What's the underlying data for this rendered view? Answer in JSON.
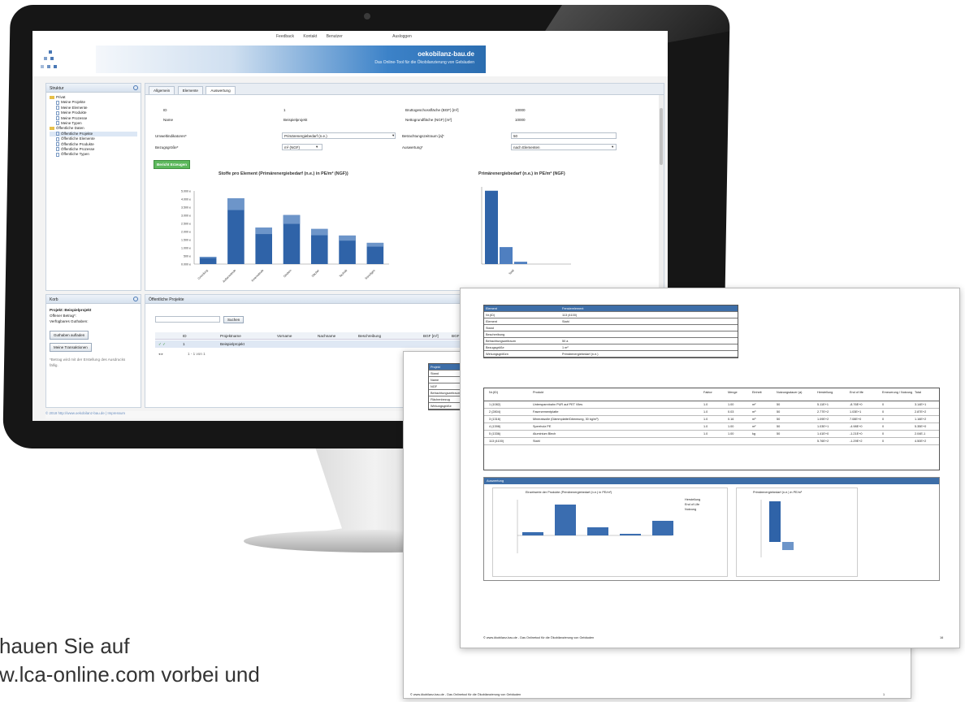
{
  "app": {
    "brand": "oekobilanz-bau.de",
    "tagline": "Das Online-Tool für die Ökobilanzierung von Gebäuden",
    "top_links": [
      "Feedback",
      "Kontakt",
      "Benutzer",
      "Ausloggen"
    ]
  },
  "explorer": {
    "title": "Struktur",
    "items": [
      {
        "label": "Privat",
        "kind": "folder",
        "level": 0
      },
      {
        "label": "Meine Projekte",
        "kind": "doc",
        "level": 1
      },
      {
        "label": "Meine Elemente",
        "kind": "doc",
        "level": 1
      },
      {
        "label": "Meine Produkte",
        "kind": "doc",
        "level": 1
      },
      {
        "label": "Meine Prozesse",
        "kind": "doc",
        "level": 1
      },
      {
        "label": "Meine Typen",
        "kind": "doc",
        "level": 1
      },
      {
        "label": "Öffentliche Daten",
        "kind": "folder",
        "level": 0
      },
      {
        "label": "Öffentliche Projekte",
        "kind": "doc",
        "level": 1,
        "selected": true
      },
      {
        "label": "Öffentliche Elemente",
        "kind": "doc",
        "level": 1
      },
      {
        "label": "Öffentliche Produkte",
        "kind": "doc",
        "level": 1
      },
      {
        "label": "Öffentliche Prozesse",
        "kind": "doc",
        "level": 1
      },
      {
        "label": "Öffentliche Typen",
        "kind": "doc",
        "level": 1
      }
    ]
  },
  "basket": {
    "title": "Korb",
    "project": "Projekt: Beispielprojekt",
    "budget": "Offener Betrag*:",
    "credit": "Verfügbares Guthaben:",
    "button1": "Guthaben aufladen",
    "button2": "Meine Transaktionen",
    "note": "*Betrag wird mit der Erstellung des Ausdrucks fällig."
  },
  "tabs": [
    "Allgemein",
    "Elemente",
    "Auswertung"
  ],
  "form": {
    "id_label": "ID",
    "id_value": "1",
    "name_label": "Name",
    "name_value": "Beispielprojekt",
    "bgf_label": "Bruttogeschossfläche (BGF) [m²]",
    "bgf_value": "10000",
    "ngf_label": "Nettogrundfläche (NGF) [m²]",
    "ngf_value": "10000",
    "indicator_label": "Umweltindikatoren*",
    "indicator_value": "Primärenergiebedarf (n.e.)",
    "period_label": "Betrachtungszeitraum [a]*",
    "period_value": "50",
    "reference_label": "Bezugsgröße*",
    "reference_value": "m² (NGF)",
    "evaluation_label": "Auswertung*",
    "evaluation_value": "nach Elementen",
    "create_button": "Bericht Erzeugen"
  },
  "chart_data": [
    {
      "type": "bar",
      "title": "Stoffe pro Element (Primärenergiebedarf (n.e.) in PE/m² (NGF))",
      "series": [
        {
          "name": "",
          "values": [
            1,
            9,
            5,
            6.7,
            4.8,
            3.9,
            2.9
          ]
        }
      ],
      "ylabel": "",
      "categories": [
        "Gründung",
        "Außenwände",
        "Innenwände",
        "Decken",
        "Dächer",
        "Technik",
        "Sonstiges"
      ],
      "ytick_labels": [
        "5.000 e",
        "4.000 e",
        "3.500 e",
        "3.000 e",
        "2.500 e",
        "2.000 e",
        "1.500 e",
        "1.000 e",
        "500 e",
        "0.000 e"
      ]
    },
    {
      "type": "bar",
      "title": "Primärenergiebedarf (n.e.) in PE/m² (NGF)",
      "series": [
        {
          "name": "",
          "values": [
            9.5,
            2.2,
            0.3
          ]
        }
      ],
      "categories": [
        "Total"
      ]
    }
  ],
  "bottom": {
    "title": "Öffentliche Projekte",
    "search_button": "Suchen",
    "columns": [
      "ID",
      "Projektname",
      "Vorname",
      "Nachname",
      "Beschreibung",
      "BGF [m²]",
      "BGF"
    ],
    "row": {
      "id": "1",
      "name": "Beispielprojekt"
    },
    "pager": "1 - 1 von 1"
  },
  "status": "© 2018 http://www.oekobilanz-bau.de | Impressum",
  "paper_back": {
    "labels": [
      "Projekt",
      "Stand",
      "Name",
      "NGF",
      "Betrachtungszeitraum",
      "Flächenbezug",
      "Wirkungsgröße"
    ],
    "footer": "© www.ökobilanz-bau.de - Das Onlinetool für die Ökobilanzierung von Gebäuden",
    "page": "1"
  },
  "paper_front": {
    "table": [
      [
        "Element",
        "Fensterelement"
      ],
      [
        "Nr.(ID)",
        "113 (4100)"
      ],
      [
        "Element",
        "Stahl"
      ],
      [
        "Stand",
        ""
      ],
      [
        "Beschreibung",
        ""
      ],
      [
        "Betrachtungszeitraum",
        "50 a"
      ],
      [
        "Bezugsgröße",
        "1 m²"
      ],
      [
        "Wirkungsgrößen",
        "Primärenergiebedarf (n.e.)"
      ]
    ],
    "product_cols": [
      "Nr.(ID)",
      "Produkt",
      "Faktor",
      "Menge",
      "Einheit",
      "Nutzungsdauer (a)",
      "Herstellung",
      "End of life",
      "Erneuerung / Nutzung",
      "Total"
    ],
    "products": [
      [
        "1 (1082)",
        "Unterspannbahn PUR auf PET Vlies",
        "1.0",
        "1.00",
        "m²",
        "50",
        "5.11E+1",
        "-8.76E+0",
        "0",
        "3.14E+1"
      ],
      [
        "2 (2804)",
        "Faserzementplatte",
        "1.0",
        "0.03",
        "m³",
        "50",
        "2.77E+2",
        "1.03E+1",
        "0",
        "2.87E+2"
      ],
      [
        "3 (1316)",
        "Mineralwolle (Dämmplatte/Dämmung, 30 kg/m³)",
        "1.0",
        "0.16",
        "m³",
        "50",
        "1.09E+2",
        "7.08E+0",
        "0",
        "1.16E+2"
      ],
      [
        "4 (1398)",
        "Sperrholz PE",
        "1.0",
        "1.00",
        "m²",
        "50",
        "1.03E+1",
        "-4.98E+0",
        "0",
        "5.35E+0"
      ],
      [
        "5 (1336)",
        "Aluminium Blech",
        "1.0",
        "1.00",
        "kg",
        "50",
        "1.41E+0",
        "-1.21E+0",
        "0",
        "2.04E-1"
      ],
      [
        "113 (4100)",
        "Stahl",
        "",
        "",
        "",
        "",
        "5.76E+2",
        "-1.29E+2",
        "0",
        "4.50E+2"
      ]
    ],
    "section": "Auswertung",
    "chart1_title": "Einzelwerte der Produkte (Primärenergiebedarf (n.e.) in PE/m²)",
    "chart2_title": "Primärenergiebedarf (n.e.) in PE/m²",
    "legend": [
      "Herstellung",
      "End of Life",
      "Nutzung"
    ],
    "footer": "© www.ökobilanz-bau.de - Das Onlinetool für die Ökobilanzierung von Gebäuden",
    "page": "16"
  },
  "caption": {
    "line1": "hauen Sie auf",
    "line2": "w.lca-online.com vorbei und"
  }
}
